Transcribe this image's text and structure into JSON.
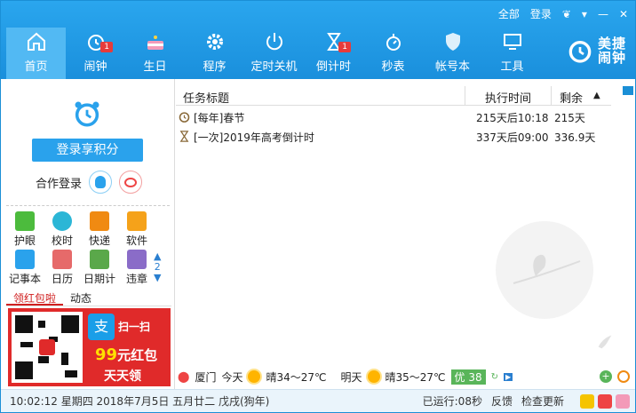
{
  "topbar": {
    "items": [
      "全部",
      "登录"
    ]
  },
  "nav": [
    {
      "key": "home",
      "label": "首页",
      "active": true
    },
    {
      "key": "alarm",
      "label": "闹钟",
      "badge": "1"
    },
    {
      "key": "birthday",
      "label": "生日"
    },
    {
      "key": "program",
      "label": "程序"
    },
    {
      "key": "shutdown",
      "label": "定时关机"
    },
    {
      "key": "countdown",
      "label": "倒计时",
      "badge": "1"
    },
    {
      "key": "stopwatch",
      "label": "秒表"
    },
    {
      "key": "account",
      "label": "帐号本"
    },
    {
      "key": "tools",
      "label": "工具"
    }
  ],
  "brand": {
    "line1": "美捷",
    "line2": "闹钟"
  },
  "left": {
    "login_button": "登录享积分",
    "coop_label": "合作登录",
    "tools": [
      {
        "label": "护眼",
        "color": "#4cbb3d"
      },
      {
        "label": "校时",
        "color": "#2bb6d6"
      },
      {
        "label": "快递",
        "color": "#f08a12"
      },
      {
        "label": "软件",
        "color": "#f5a21a"
      },
      {
        "label": "记事本",
        "color": "#2aa2ec"
      },
      {
        "label": "日历",
        "color": "#e66a6a"
      },
      {
        "label": "日期计",
        "color": "#5aa84a"
      },
      {
        "label": "违章",
        "color": "#8a6cc8"
      }
    ],
    "page_number": "2",
    "tabs": [
      "领红包啦",
      "动态"
    ],
    "ad": {
      "alipay": "支",
      "scan": "扫一扫",
      "amount": "99",
      "amount_text": "元红包",
      "daily": "天天领"
    }
  },
  "table": {
    "headers": {
      "title": "任务标题",
      "time": "执行时间",
      "remain": "剩余"
    },
    "rows": [
      {
        "icon": "alarm-clock-icon",
        "title": "[每年]春节",
        "time": "215天后10:18",
        "remain": "215天"
      },
      {
        "icon": "hourglass-icon",
        "title": "[一次]2019年高考倒计时",
        "time": "337天后09:00",
        "remain": "336.9天"
      }
    ]
  },
  "weather": {
    "city": "厦门",
    "today_label": "今天",
    "today": "晴34～27℃",
    "tomorrow_label": "明天",
    "tomorrow": "晴35～27℃",
    "aqi": "优 38"
  },
  "status": {
    "datetime": "10:02:12 星期四 2018年7月5日 五月廿二 戊戌(狗年)",
    "uptime": "已运行:08秒",
    "feedback": "反馈",
    "update": "检查更新"
  },
  "colors": {
    "accent": "#1a8fdc",
    "badge": "#e63b3b"
  }
}
